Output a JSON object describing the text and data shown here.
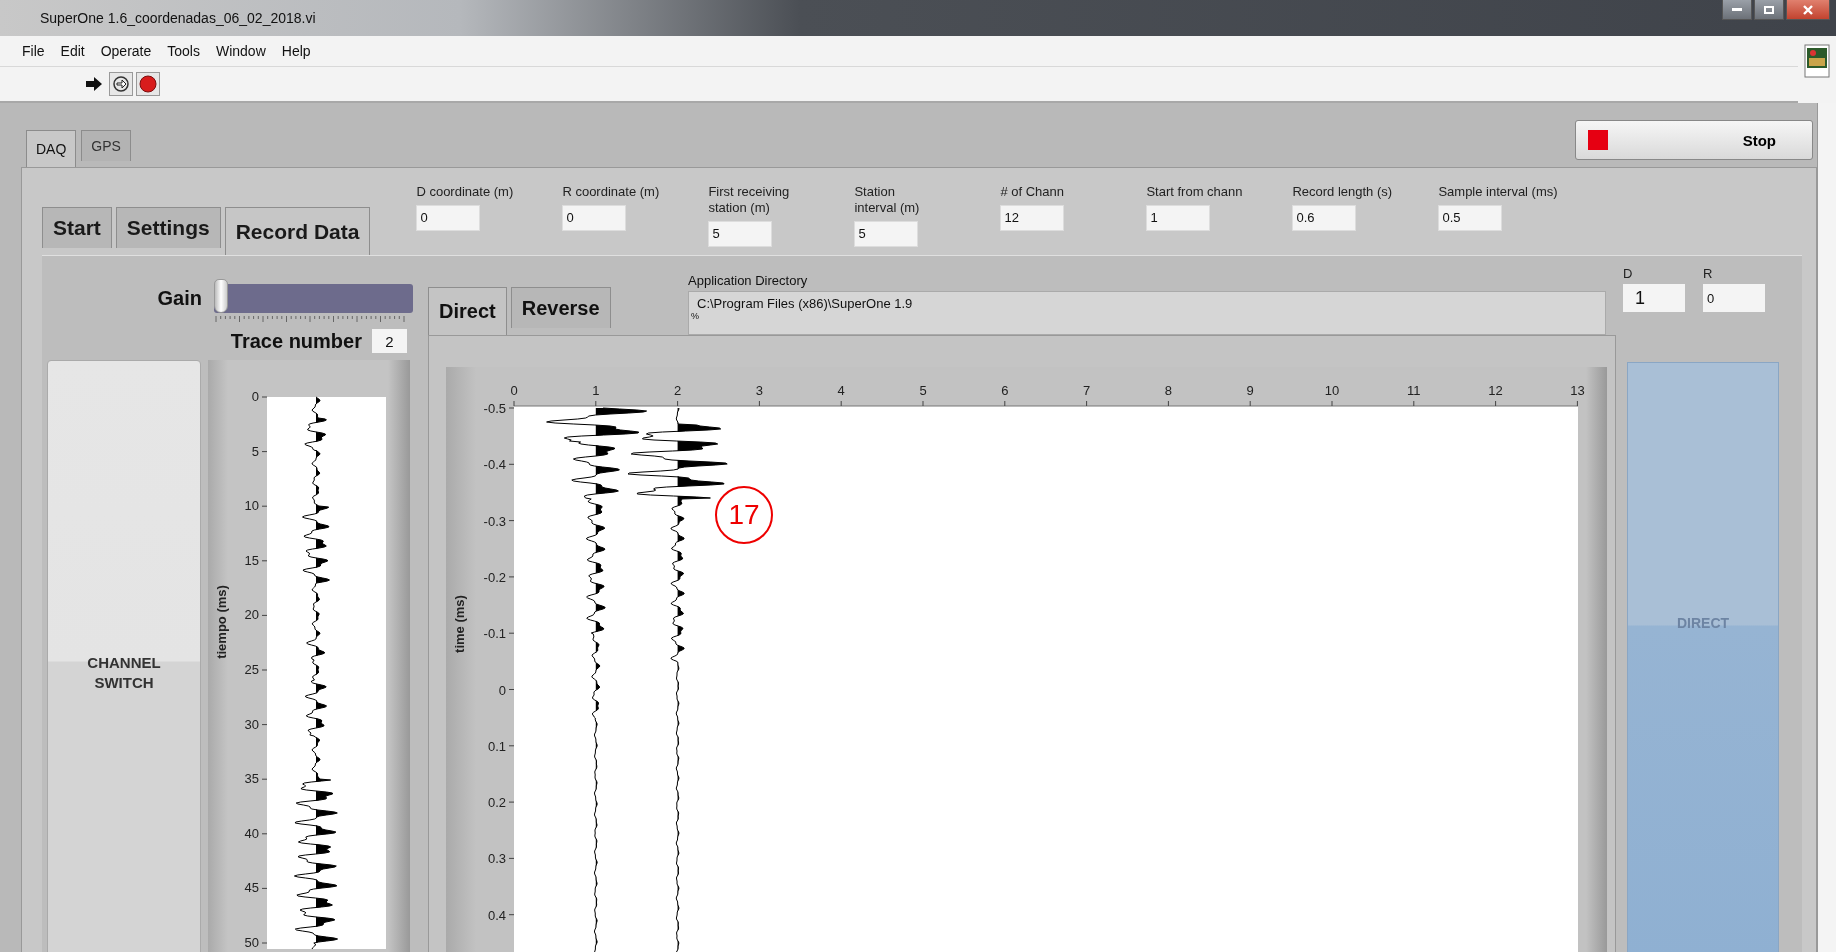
{
  "window": {
    "title": "SuperOne 1.6_coordenadas_06_02_2018.vi"
  },
  "menu": [
    "File",
    "Edit",
    "Operate",
    "Tools",
    "Window",
    "Help"
  ],
  "main_tabs": [
    {
      "label": "DAQ",
      "selected": true
    },
    {
      "label": "GPS",
      "selected": false
    }
  ],
  "stop_button": {
    "label": "Stop"
  },
  "sub_tabs": [
    {
      "label": "Start",
      "selected": false
    },
    {
      "label": "Settings",
      "selected": false
    },
    {
      "label": "Record Data",
      "selected": true
    }
  ],
  "parameters": [
    {
      "label": "D coordinate (m)",
      "value": "0"
    },
    {
      "label": "R coordinate (m)",
      "value": "0"
    },
    {
      "label": "First receiving\nstation (m)",
      "value": "5"
    },
    {
      "label": "Station\ninterval (m)",
      "value": "5"
    },
    {
      "label": "# of Chann",
      "value": "12"
    },
    {
      "label": "Start from chann",
      "value": "1"
    },
    {
      "label": "Record length (s)",
      "value": "0.6"
    },
    {
      "label": "Sample interval (ms)",
      "value": "0.5"
    }
  ],
  "gain": {
    "label": "Gain",
    "level": 0.0
  },
  "trace_number": {
    "label": "Trace number",
    "value": "2"
  },
  "channel_switch": {
    "label": "CHANNEL\nSWITCH"
  },
  "trace_plot": {
    "ylabel": "tiempo (ms)",
    "yticks": [
      "0",
      "5",
      "10",
      "15",
      "20",
      "25",
      "30",
      "35",
      "40",
      "45",
      "50"
    ]
  },
  "view_tabs": [
    {
      "label": "Direct",
      "selected": true
    },
    {
      "label": "Reverse",
      "selected": false
    }
  ],
  "app_directory": {
    "label": "Application Directory",
    "value": "C:\\Program Files (x86)\\SuperOne 1.9",
    "marker": "%"
  },
  "shot_plot": {
    "ylabel": "time (ms)",
    "xticks": [
      "0",
      "1",
      "2",
      "3",
      "4",
      "5",
      "6",
      "7",
      "8",
      "9",
      "10",
      "11",
      "12",
      "13"
    ],
    "yticks": [
      "-0.5",
      "-0.4",
      "-0.3",
      "-0.2",
      "-0.1",
      "0",
      "0.1",
      "0.2",
      "0.3",
      "0.4"
    ]
  },
  "annotation": {
    "label": "17"
  },
  "position": [
    {
      "label": "D",
      "value": "1"
    },
    {
      "label": "R",
      "value": "0"
    }
  ],
  "direction_button": {
    "label": "DIRECT"
  }
}
